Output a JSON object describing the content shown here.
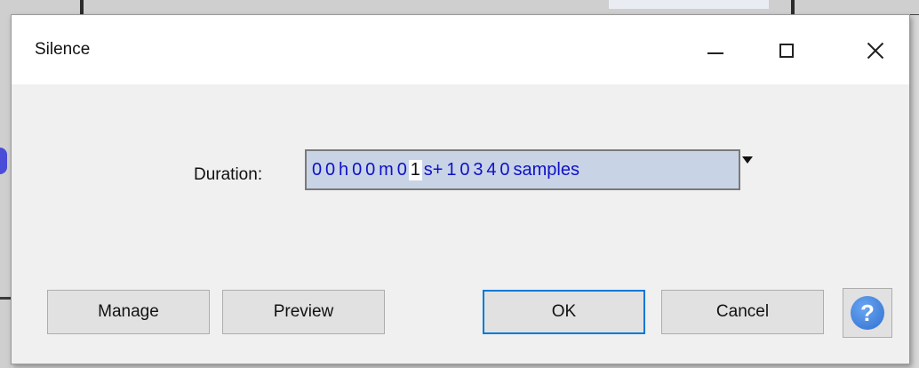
{
  "window": {
    "title": "Silence"
  },
  "form": {
    "duration_label": "Duration:",
    "duration": {
      "h_digits": [
        "0",
        "0"
      ],
      "h_unit": "h",
      "m_digits": [
        "0",
        "0"
      ],
      "m_unit": "m",
      "s_digits": [
        "0",
        "1"
      ],
      "s_unit": "s+",
      "samples_digits": [
        "1",
        "0",
        "3",
        "4",
        "0"
      ],
      "samples_unit": "samples"
    }
  },
  "buttons": {
    "manage": "Manage",
    "preview": "Preview",
    "ok": "OK",
    "cancel": "Cancel",
    "help": "?"
  },
  "icons": {
    "minimize": "minimize-icon",
    "maximize": "maximize-icon",
    "close": "close-icon",
    "help": "help-icon",
    "dropdown": "dropdown-arrow-icon"
  },
  "colors": {
    "field_bg": "#c8d4e6",
    "digit": "#1010c8",
    "ok_border": "#0078d7",
    "help": "#2f6fd0"
  }
}
